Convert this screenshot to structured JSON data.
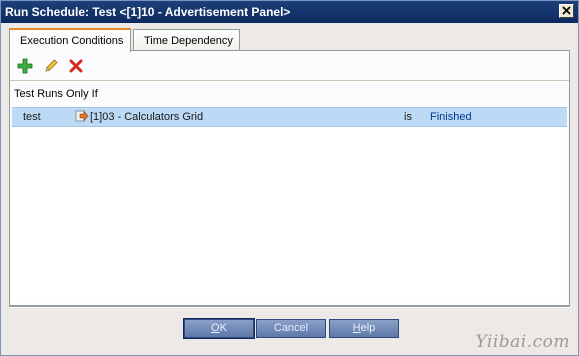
{
  "window": {
    "title": "Run Schedule: Test <[1]10 - Advertisement Panel>"
  },
  "tabs": [
    {
      "label": "Execution Conditions",
      "active": true
    },
    {
      "label": "Time Dependency",
      "active": false
    }
  ],
  "toolbar": {
    "icons": [
      "add-icon",
      "edit-icon",
      "delete-icon"
    ]
  },
  "conditions": {
    "section_label": "Test Runs Only If",
    "rows": [
      {
        "name": "test",
        "icon": "test-run-arrow-icon",
        "target": "[1]03 - Calculators Grid",
        "operator": "is",
        "status": "Finished"
      }
    ]
  },
  "buttons": {
    "ok_prefix": "",
    "ok_underline": "O",
    "ok_rest": "K",
    "cancel": "Cancel",
    "help_underline": "H",
    "help_rest": "elp"
  },
  "watermark": "Yiibai.com",
  "colors": {
    "titlebar": "#0d2a5f",
    "selection": "#bcd9f5",
    "status_text": "#003a8c",
    "add_icon": "#2f9d2f",
    "delete_icon": "#d8261b"
  }
}
